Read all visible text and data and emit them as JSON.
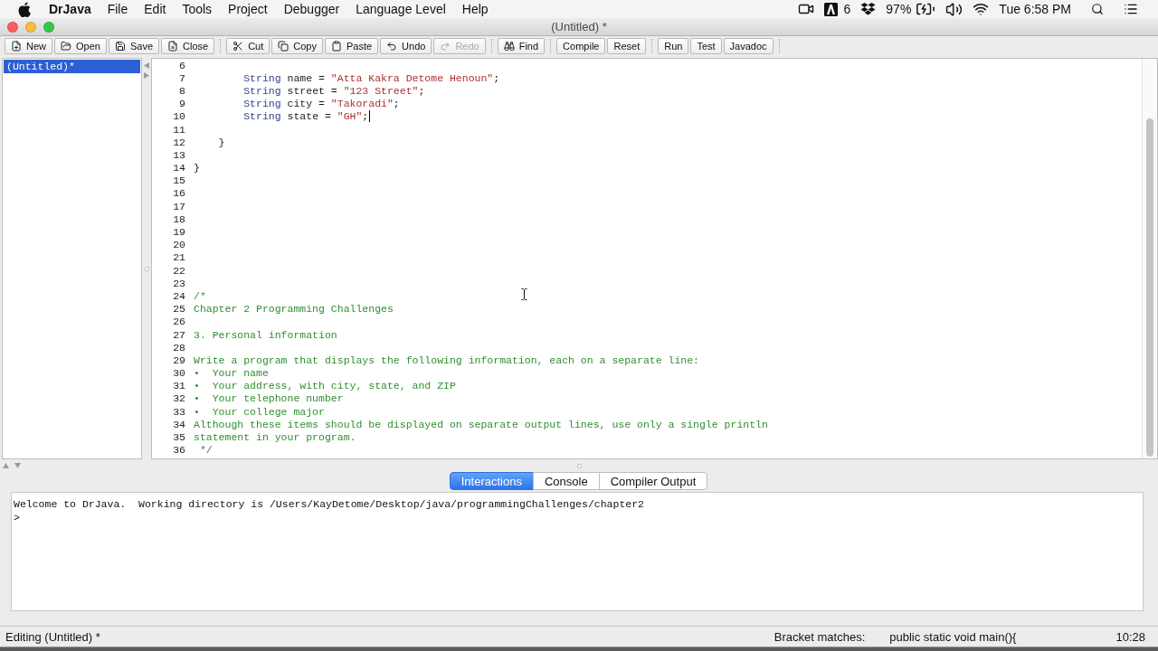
{
  "menu_bar": {
    "app_name": "DrJava",
    "menus": [
      "File",
      "Edit",
      "Tools",
      "Project",
      "Debugger",
      "Language Level",
      "Help"
    ],
    "tray": {
      "count": "6",
      "battery": "97%",
      "clock": "Tue 6:58 PM"
    }
  },
  "window": {
    "title": "(Untitled) *"
  },
  "toolbar": {
    "groups": [
      [
        {
          "label": "New",
          "disabled": false
        },
        {
          "label": "Open",
          "disabled": false
        },
        {
          "label": "Save",
          "disabled": false
        },
        {
          "label": "Close",
          "disabled": false
        }
      ],
      [
        {
          "label": "Cut",
          "disabled": false
        },
        {
          "label": "Copy",
          "disabled": false
        },
        {
          "label": "Paste",
          "disabled": false
        },
        {
          "label": "Undo",
          "disabled": false
        },
        {
          "label": "Redo",
          "disabled": true
        }
      ],
      [
        {
          "label": "Find",
          "disabled": false
        }
      ],
      [
        {
          "label": "Compile",
          "disabled": false
        },
        {
          "label": "Reset",
          "disabled": false
        }
      ],
      [
        {
          "label": "Run",
          "disabled": false
        },
        {
          "label": "Test",
          "disabled": false
        },
        {
          "label": "Javadoc",
          "disabled": false
        }
      ]
    ]
  },
  "documents": [
    {
      "name": "(Untitled)*",
      "selected": true
    }
  ],
  "editor": {
    "lines": [
      {
        "number": "6",
        "cursor": false
      },
      {
        "number": "7",
        "cursor": false,
        "tokens": [
          {
            "kind": "keyword",
            "text": "        String"
          },
          {
            "kind": "plain",
            "text": " name = "
          },
          {
            "kind": "string",
            "text": "\"Atta Kakra Detome Henoun\""
          },
          {
            "kind": "plain",
            "text": ";"
          }
        ]
      },
      {
        "number": "8",
        "cursor": false,
        "tokens": [
          {
            "kind": "keyword",
            "text": "        String"
          },
          {
            "kind": "plain",
            "text": " street = "
          },
          {
            "kind": "string",
            "text": "\"123 Street\""
          },
          {
            "kind": "plain",
            "text": ";"
          }
        ]
      },
      {
        "number": "9",
        "cursor": false,
        "tokens": [
          {
            "kind": "keyword",
            "text": "        String"
          },
          {
            "kind": "plain",
            "text": " city = "
          },
          {
            "kind": "string",
            "text": "\"Takoradi\""
          },
          {
            "kind": "plain",
            "text": ";"
          }
        ]
      },
      {
        "number": "10",
        "cursor": true,
        "tokens": [
          {
            "kind": "keyword",
            "text": "        String"
          },
          {
            "kind": "plain",
            "text": " state = "
          },
          {
            "kind": "string",
            "text": "\"GH\""
          },
          {
            "kind": "plain",
            "text": ";"
          }
        ]
      },
      {
        "number": "11",
        "cursor": false
      },
      {
        "number": "12",
        "cursor": false,
        "tokens": [
          {
            "kind": "plain",
            "text": "    }"
          }
        ]
      },
      {
        "number": "13",
        "cursor": false
      },
      {
        "number": "14",
        "cursor": false,
        "tokens": [
          {
            "kind": "plain",
            "text": "}"
          }
        ]
      },
      {
        "number": "15",
        "cursor": false
      },
      {
        "number": "16",
        "cursor": false
      },
      {
        "number": "17",
        "cursor": false
      },
      {
        "number": "18",
        "cursor": false
      },
      {
        "number": "19",
        "cursor": false
      },
      {
        "number": "20",
        "cursor": false
      },
      {
        "number": "21",
        "cursor": false
      },
      {
        "number": "22",
        "cursor": false
      },
      {
        "number": "23",
        "cursor": false
      },
      {
        "number": "24",
        "cursor": false,
        "tokens": [
          {
            "kind": "comment",
            "text": "/*"
          }
        ]
      },
      {
        "number": "25",
        "cursor": false,
        "tokens": [
          {
            "kind": "comment",
            "text": "Chapter 2 Programming Challenges"
          }
        ]
      },
      {
        "number": "26",
        "cursor": false
      },
      {
        "number": "27",
        "cursor": false,
        "tokens": [
          {
            "kind": "comment",
            "text": "3. Personal information"
          }
        ]
      },
      {
        "number": "28",
        "cursor": false
      },
      {
        "number": "29",
        "cursor": false,
        "tokens": [
          {
            "kind": "comment",
            "text": "Write a program that displays the following information, each on a separate line:"
          }
        ]
      },
      {
        "number": "30",
        "cursor": false,
        "tokens": [
          {
            "kind": "comment",
            "text": "•  Your name"
          }
        ]
      },
      {
        "number": "31",
        "cursor": false,
        "tokens": [
          {
            "kind": "comment",
            "text": "•  Your address, with city, state, and ZIP"
          }
        ]
      },
      {
        "number": "32",
        "cursor": false,
        "tokens": [
          {
            "kind": "comment",
            "text": "•  Your telephone number"
          }
        ]
      },
      {
        "number": "33",
        "cursor": false,
        "tokens": [
          {
            "kind": "comment",
            "text": "•  Your college major"
          }
        ]
      },
      {
        "number": "34",
        "cursor": false,
        "tokens": [
          {
            "kind": "comment",
            "text": "Although these items should be displayed on separate output lines, use only a single println"
          }
        ]
      },
      {
        "number": "35",
        "cursor": false,
        "tokens": [
          {
            "kind": "comment",
            "text": "statement in your program."
          }
        ]
      },
      {
        "number": "36",
        "cursor": false,
        "tokens": [
          {
            "kind": "comment",
            "text": " */"
          }
        ]
      }
    ]
  },
  "bottom_tabs": [
    {
      "label": "Interactions",
      "selected": true
    },
    {
      "label": "Console",
      "selected": false
    },
    {
      "label": "Compiler Output",
      "selected": false
    }
  ],
  "interactions": {
    "lines": [
      "Welcome to DrJava.  Working directory is /Users/KayDetome/Desktop/java/programmingChallenges/chapter2",
      ">"
    ]
  },
  "status_bar": {
    "message": "Editing (Untitled) *",
    "bracket_label": "Bracket matches:",
    "bracket_value": "public static void main(){",
    "position": "10:28"
  }
}
